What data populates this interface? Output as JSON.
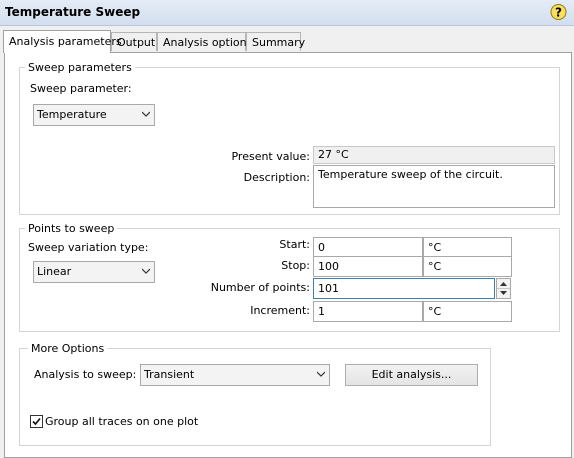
{
  "window": {
    "title": "Temperature Sweep"
  },
  "tabs": [
    {
      "label": "Analysis parameters"
    },
    {
      "label": "Output"
    },
    {
      "label": "Analysis options"
    },
    {
      "label": "Summary"
    }
  ],
  "sweep_parameters": {
    "group_title": "Sweep parameters",
    "parameter_label": "Sweep parameter:",
    "parameter_value": "Temperature",
    "present_value_label": "Present value:",
    "present_value": "27 °C",
    "description_label": "Description:",
    "description": "Temperature sweep of the circuit."
  },
  "points": {
    "group_title": "Points to sweep",
    "variation_label": "Sweep variation type:",
    "variation_value": "Linear",
    "start_label": "Start:",
    "start_value": "0",
    "start_unit": "°C",
    "stop_label": "Stop:",
    "stop_value": "100",
    "stop_unit": "°C",
    "num_points_label": "Number of points:",
    "num_points_value": "101",
    "increment_label": "Increment:",
    "increment_value": "1",
    "increment_unit": "°C"
  },
  "more_options": {
    "group_title": "More Options",
    "analysis_label": "Analysis to sweep:",
    "analysis_value": "Transient",
    "edit_button": "Edit analysis...",
    "group_traces_label": "Group all traces on one plot",
    "group_traces_checked": true
  },
  "icons": {
    "help": "help-icon",
    "dropdown": "chevron-down-icon",
    "spinner_up": "spin-up-icon",
    "spinner_down": "spin-down-icon",
    "checkmark": "checkmark-icon"
  }
}
